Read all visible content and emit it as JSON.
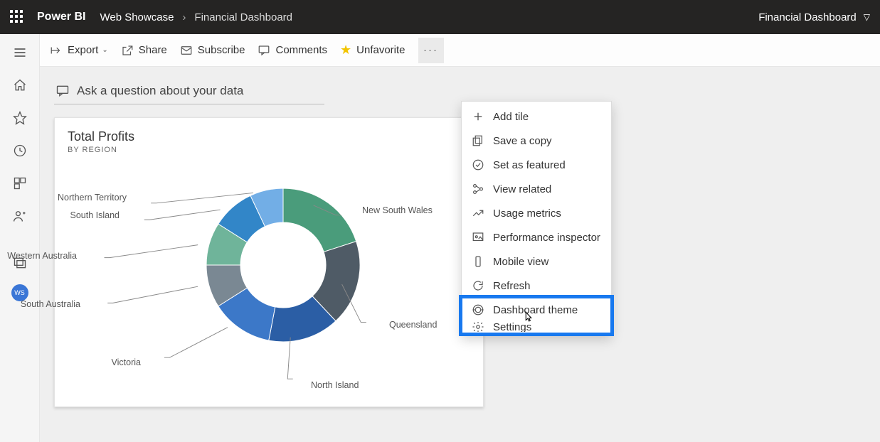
{
  "topbar": {
    "brand": "Power BI",
    "crumb1": "Web Showcase",
    "crumb2": "Financial Dashboard",
    "right_title": "Financial Dashboard"
  },
  "leftnav": {
    "avatar_initials": "WS"
  },
  "toolbar": {
    "export": "Export",
    "share": "Share",
    "subscribe": "Subscribe",
    "comments": "Comments",
    "unfavorite": "Unfavorite"
  },
  "qna": {
    "placeholder": "Ask a question about your data"
  },
  "tile": {
    "title": "Total Profits",
    "subtitle": "BY REGION"
  },
  "chart_data": {
    "type": "pie",
    "title": "Total Profits",
    "subtitle": "BY REGION",
    "series": [
      {
        "name": "New South Wales",
        "value": 20,
        "color": "#4a9c7b"
      },
      {
        "name": "Queensland",
        "value": 18,
        "color": "#4f5b66"
      },
      {
        "name": "North Island",
        "value": 15,
        "color": "#2b5ea5"
      },
      {
        "name": "Victoria",
        "value": 13,
        "color": "#3c78c8"
      },
      {
        "name": "South Australia",
        "value": 9,
        "color": "#7a8893"
      },
      {
        "name": "Western Australia",
        "value": 9,
        "color": "#6fb49a"
      },
      {
        "name": "South Island",
        "value": 9,
        "color": "#3286c8"
      },
      {
        "name": "Northern Territory",
        "value": 7,
        "color": "#72aee6"
      }
    ]
  },
  "menu": {
    "items": [
      {
        "label": "Add tile"
      },
      {
        "label": "Save a copy"
      },
      {
        "label": "Set as featured"
      },
      {
        "label": "View related"
      },
      {
        "label": "Usage metrics"
      },
      {
        "label": "Performance inspector"
      },
      {
        "label": "Mobile view"
      },
      {
        "label": "Refresh"
      },
      {
        "label": "Dashboard theme"
      },
      {
        "label": "Settings"
      }
    ],
    "highlighted_index": 8
  }
}
